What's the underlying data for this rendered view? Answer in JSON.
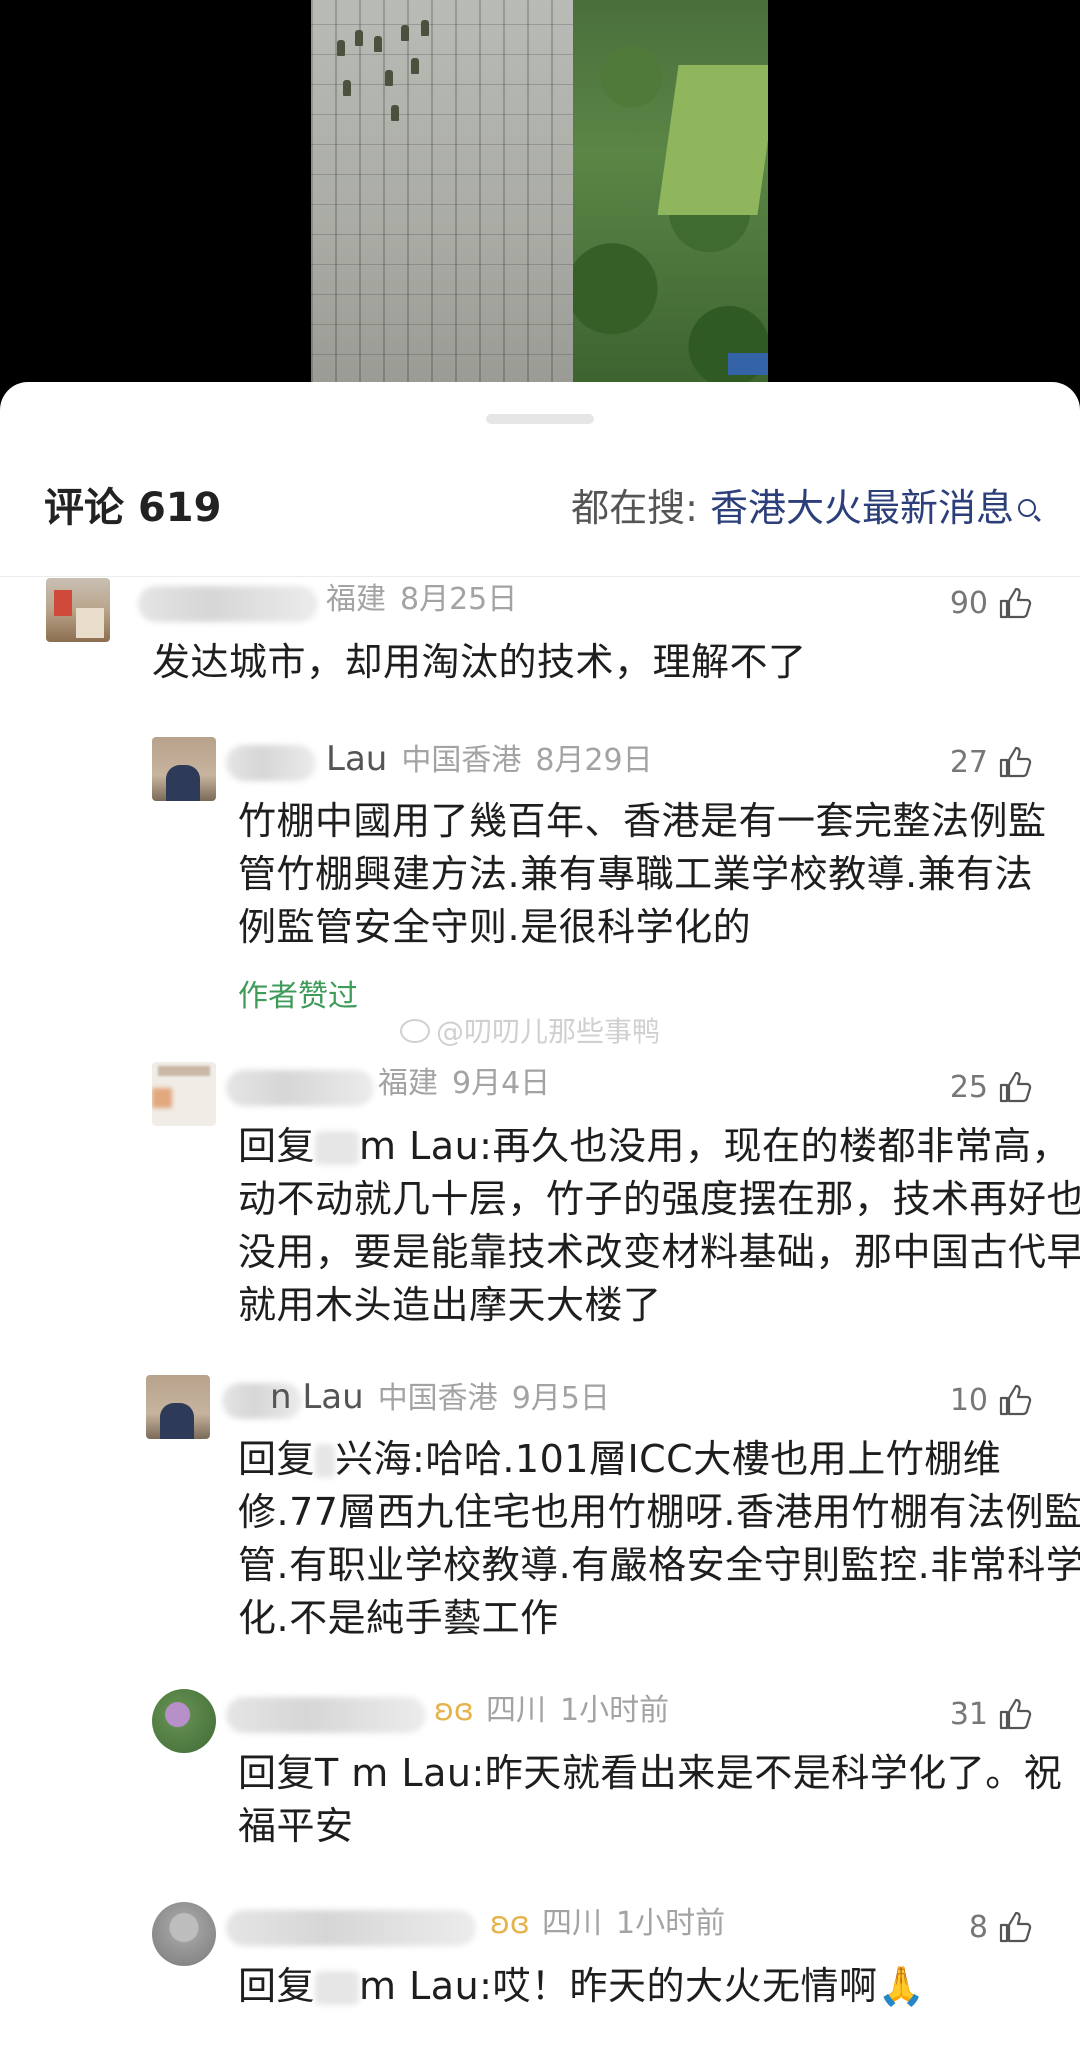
{
  "sheet": {
    "comments_label": "评论",
    "comments_count": "619",
    "hot_search_prefix": "都在搜: ",
    "hot_search_term": "香港大火最新消息"
  },
  "watermark": "@叨叨儿那些事鸭",
  "comments": [
    {
      "username": "",
      "region": "福建",
      "date": "8月25日",
      "likes": "90",
      "text": "发达城市，却用淘汰的技术，理解不了"
    },
    {
      "username": "Lau",
      "region": "中国香港",
      "date": "8月29日",
      "likes": "27",
      "text": "竹棚中國用了幾百年、香港是有一套完整法例監管竹棚興建方法.兼有專職工業学校教導.兼有法例監管安全守则.是很科学化的",
      "author_liked": "作者赞过"
    },
    {
      "username": "",
      "region": "福建",
      "date": "9月4日",
      "likes": "25",
      "reply_prefix": "回复",
      "reply_to": "m Lau",
      "text": ":再久也没用，现在的楼都非常高，动不动就几十层，竹子的强度摆在那，技术再好也没用，要是能靠技术改变材料基础，那中国古代早就用木头造出摩天大楼了"
    },
    {
      "username": "n Lau",
      "region": "中国香港",
      "date": "9月5日",
      "likes": "10",
      "reply_prefix": "回复",
      "reply_to": "兴海",
      "text": ":哈哈.101層ICC大樓也用上竹棚维修.77層西九住宅也用竹棚呀.香港用竹棚有法例監管.有职业学校教導.有嚴格安全守則監控.非常科学化.不是純手藝工作"
    },
    {
      "username": "",
      "region": "四川",
      "date": "1小时前",
      "likes": "31",
      "reply_prefix": "回复",
      "reply_to": "T  m Lau",
      "text": ":昨天就看出来是不是科学化了。祝福平安"
    },
    {
      "username": "",
      "region": "四川",
      "date": "1小时前",
      "likes": "8",
      "reply_prefix": "回复",
      "reply_to": "m Lau",
      "text": ":哎！昨天的大火无情啊🙏"
    }
  ],
  "colors": {
    "hot_search": "#2d3f7a",
    "author_liked": "#3f9b5a",
    "meta_gray": "#a3a3a3"
  },
  "icons": [
    "thumbs-up-icon",
    "search-icon",
    "weibo-icon",
    "vip-wing-icon"
  ]
}
